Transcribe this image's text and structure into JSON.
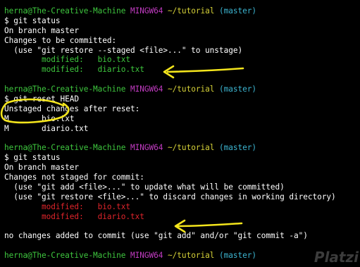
{
  "theme": {
    "background": "#000000",
    "text": "#ffffff",
    "prompt_user": "#3ec73e",
    "prompt_env": "#c33cc3",
    "prompt_path": "#d6d238",
    "prompt_branch": "#3cb5d1",
    "staged": "#3ec73e",
    "unstaged": "#e0242b",
    "annotation": "#f4e51c"
  },
  "prompt": {
    "user": "herna@The-Creative-Machine",
    "env": "MINGW64",
    "path": "~/tutorial",
    "branch": "(master)"
  },
  "block1": {
    "command": "$ git status",
    "on_branch": "On branch master",
    "header": "Changes to be committed:",
    "hint": "  (use \"git restore --staged <file>...\" to unstage)",
    "files": [
      {
        "status": "        modified:   ",
        "name": "bio.txt"
      },
      {
        "status": "        modified:   ",
        "name": "diario.txt"
      }
    ]
  },
  "block2": {
    "command": "$ git reset HEAD",
    "header": "Unstaged changes after reset:",
    "files": [
      {
        "flag": "M",
        "name": "bio.txt"
      },
      {
        "flag": "M",
        "name": "diario.txt"
      }
    ]
  },
  "block3": {
    "command": "$ git status",
    "on_branch": "On branch master",
    "header": "Changes not staged for commit:",
    "hint1": "  (use \"git add <file>...\" to update what will be committed)",
    "hint2": "  (use \"git restore <file>...\" to discard changes in working directory)",
    "files": [
      {
        "status": "        modified:   ",
        "name": "bio.txt"
      },
      {
        "status": "        modified:   ",
        "name": "diario.txt"
      }
    ],
    "footer": "no changes added to commit (use \"git add\" and/or \"git commit -a\")"
  },
  "watermark": "Platzi"
}
